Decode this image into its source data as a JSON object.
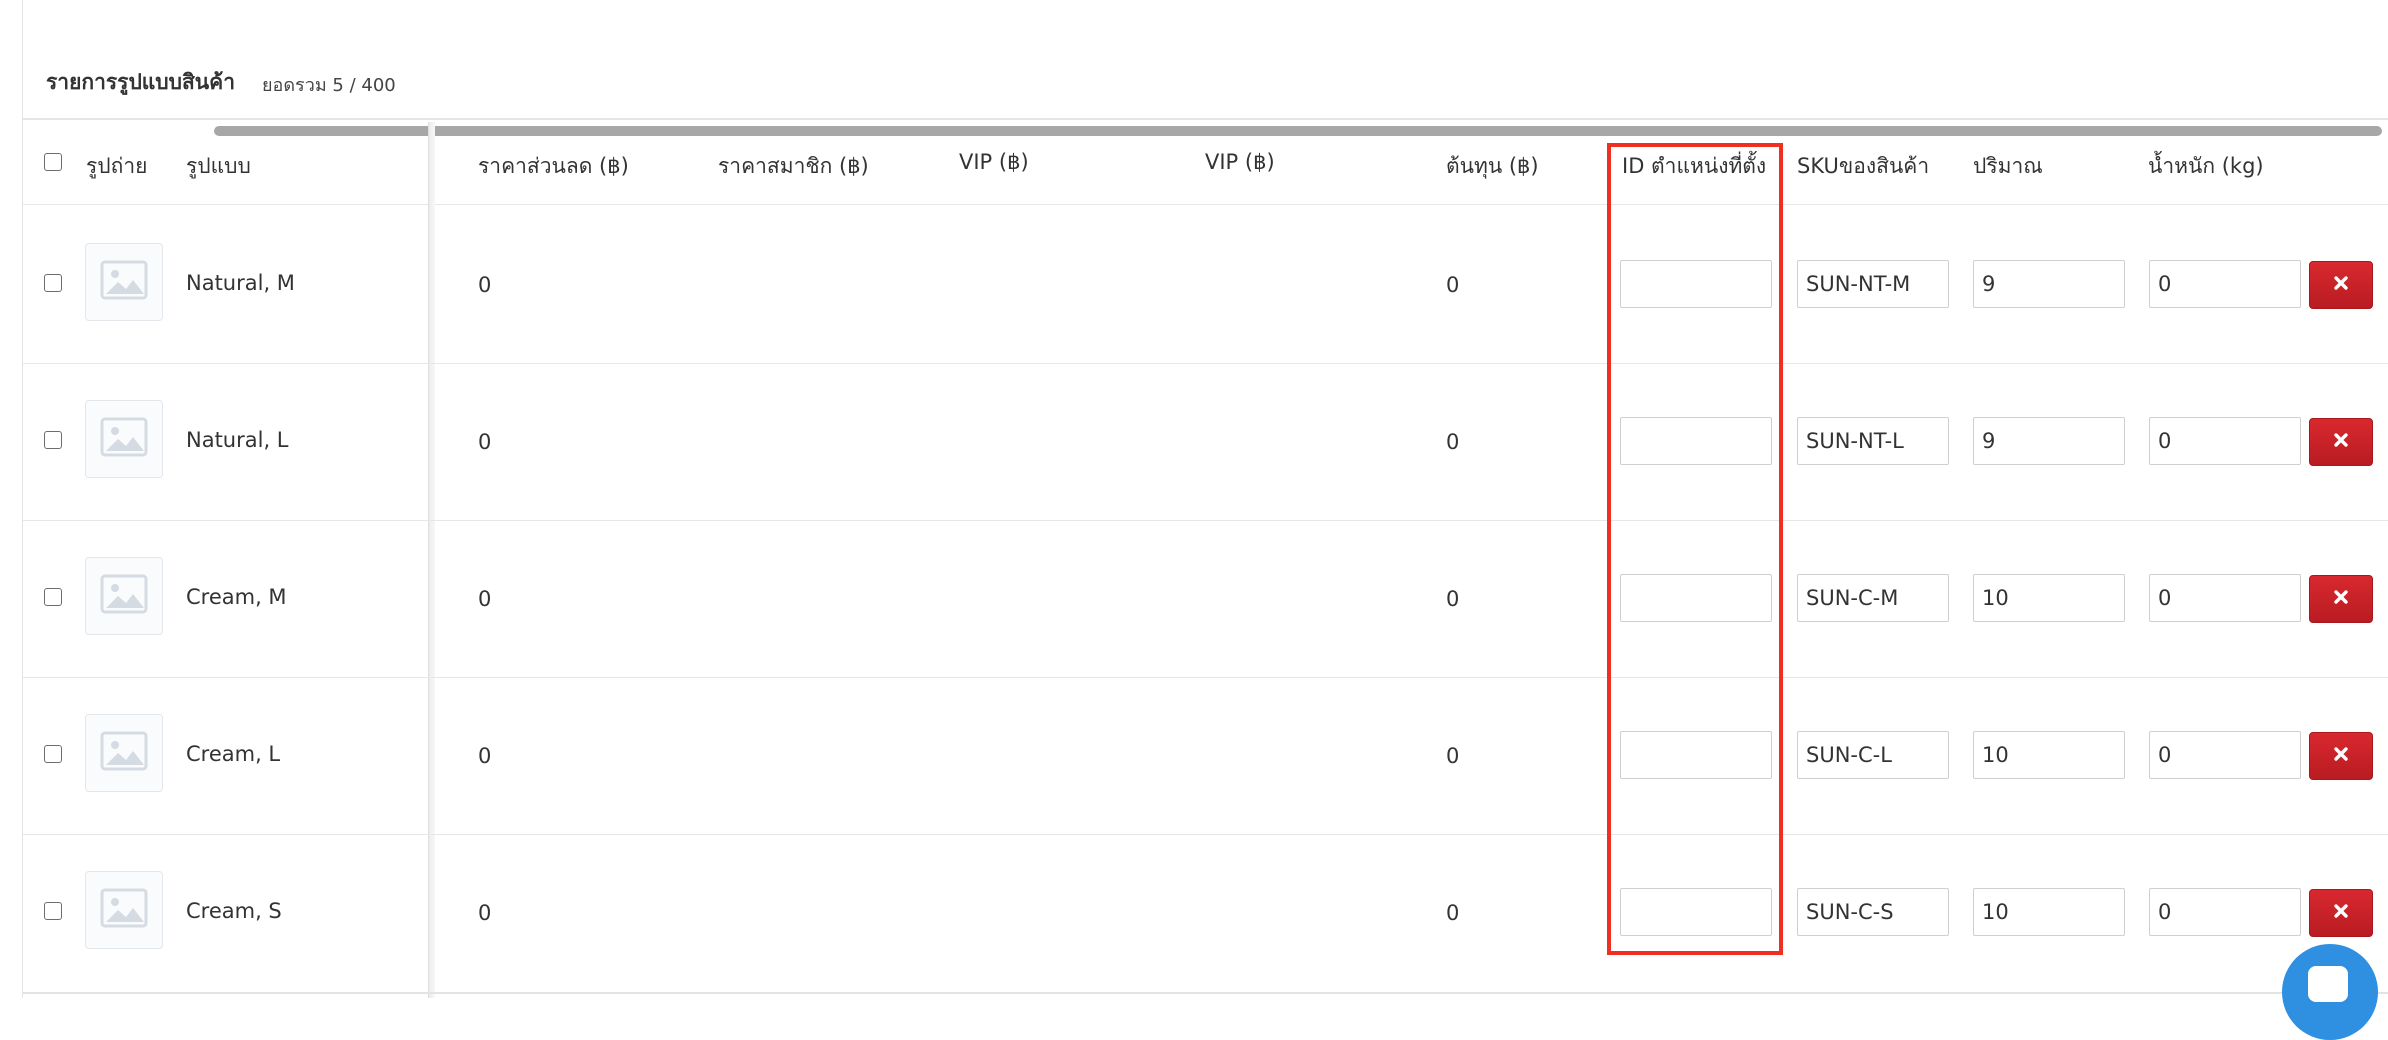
{
  "section": {
    "title": "รายการรูปแบบสินค้า",
    "count": "ยอดรวม 5 / 400"
  },
  "columns": {
    "photo": "รูปถ่าย",
    "variant": "รูปแบบ",
    "retail_price": "ราคาส่วนลด (฿)",
    "member_price": "ราคาสมาชิก (฿)",
    "vip1": "VIP (฿)",
    "vip2": "VIP (฿)",
    "cost": "ต้นทุน (฿)",
    "location_id": "ID ตำแหน่งที่ตั้ง",
    "sku": "SKUของสินค้า",
    "quantity": "ปริมาณ",
    "weight": "น้ำหนัก (kg)"
  },
  "rows": [
    {
      "variant": "Natural, M",
      "retail_price": "0",
      "cost": "0",
      "location_id": "",
      "sku": "SUN-NT-M",
      "quantity": "9",
      "weight": "0"
    },
    {
      "variant": "Natural, L",
      "retail_price": "0",
      "cost": "0",
      "location_id": "",
      "sku": "SUN-NT-L",
      "quantity": "9",
      "weight": "0"
    },
    {
      "variant": "Cream, M",
      "retail_price": "0",
      "cost": "0",
      "location_id": "",
      "sku": "SUN-C-M",
      "quantity": "10",
      "weight": "0"
    },
    {
      "variant": "Cream, L",
      "retail_price": "0",
      "cost": "0",
      "location_id": "",
      "sku": "SUN-C-L",
      "quantity": "10",
      "weight": "0"
    },
    {
      "variant": "Cream, S",
      "retail_price": "0",
      "cost": "0",
      "location_id": "",
      "sku": "SUN-C-S",
      "quantity": "10",
      "weight": "0"
    }
  ],
  "icons": {
    "delete": "close-icon",
    "thumbnail": "image-placeholder-icon",
    "chat": "chat-icon"
  },
  "colors": {
    "delete_button": "#c9232a",
    "highlight_box": "#ef2f1f",
    "chat_fab": "#2f8fe0"
  }
}
